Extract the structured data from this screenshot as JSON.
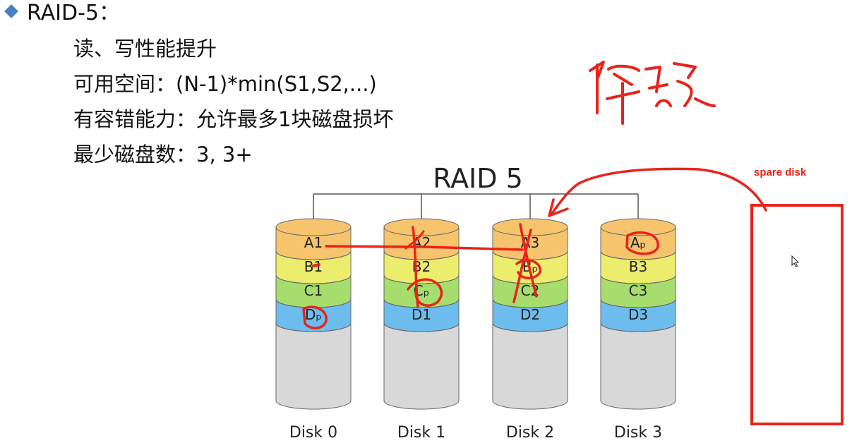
{
  "slide": {
    "title": "RAID-5：",
    "lines": [
      "读、写性能提升",
      "可用空间：(N-1)*min(S1,S2,...)",
      "有容错能力：允许最多1块磁盘损坏",
      "最少磁盘数：3, 3+"
    ]
  },
  "diagram": {
    "title": "RAID 5",
    "disks": [
      {
        "label": "Disk 0",
        "blocks": [
          "A1",
          "B1",
          "C1",
          "Dₚ"
        ]
      },
      {
        "label": "Disk 1",
        "blocks": [
          "A2",
          "B2",
          "Cₚ",
          "D1"
        ]
      },
      {
        "label": "Disk 2",
        "blocks": [
          "A3",
          "Bₚ",
          "C2",
          "D2"
        ]
      },
      {
        "label": "Disk 3",
        "blocks": [
          "Aₚ",
          "B3",
          "C3",
          "D3"
        ]
      }
    ],
    "stripe_colors": [
      "#f6c46d",
      "#eded6d",
      "#a6dd6d",
      "#6dbcee"
    ],
    "empty_color": "#d8d8d8"
  },
  "annotations": {
    "handwriting": "降级",
    "spare_disk_label": "spare disk",
    "ink_color": "#e8231b"
  }
}
